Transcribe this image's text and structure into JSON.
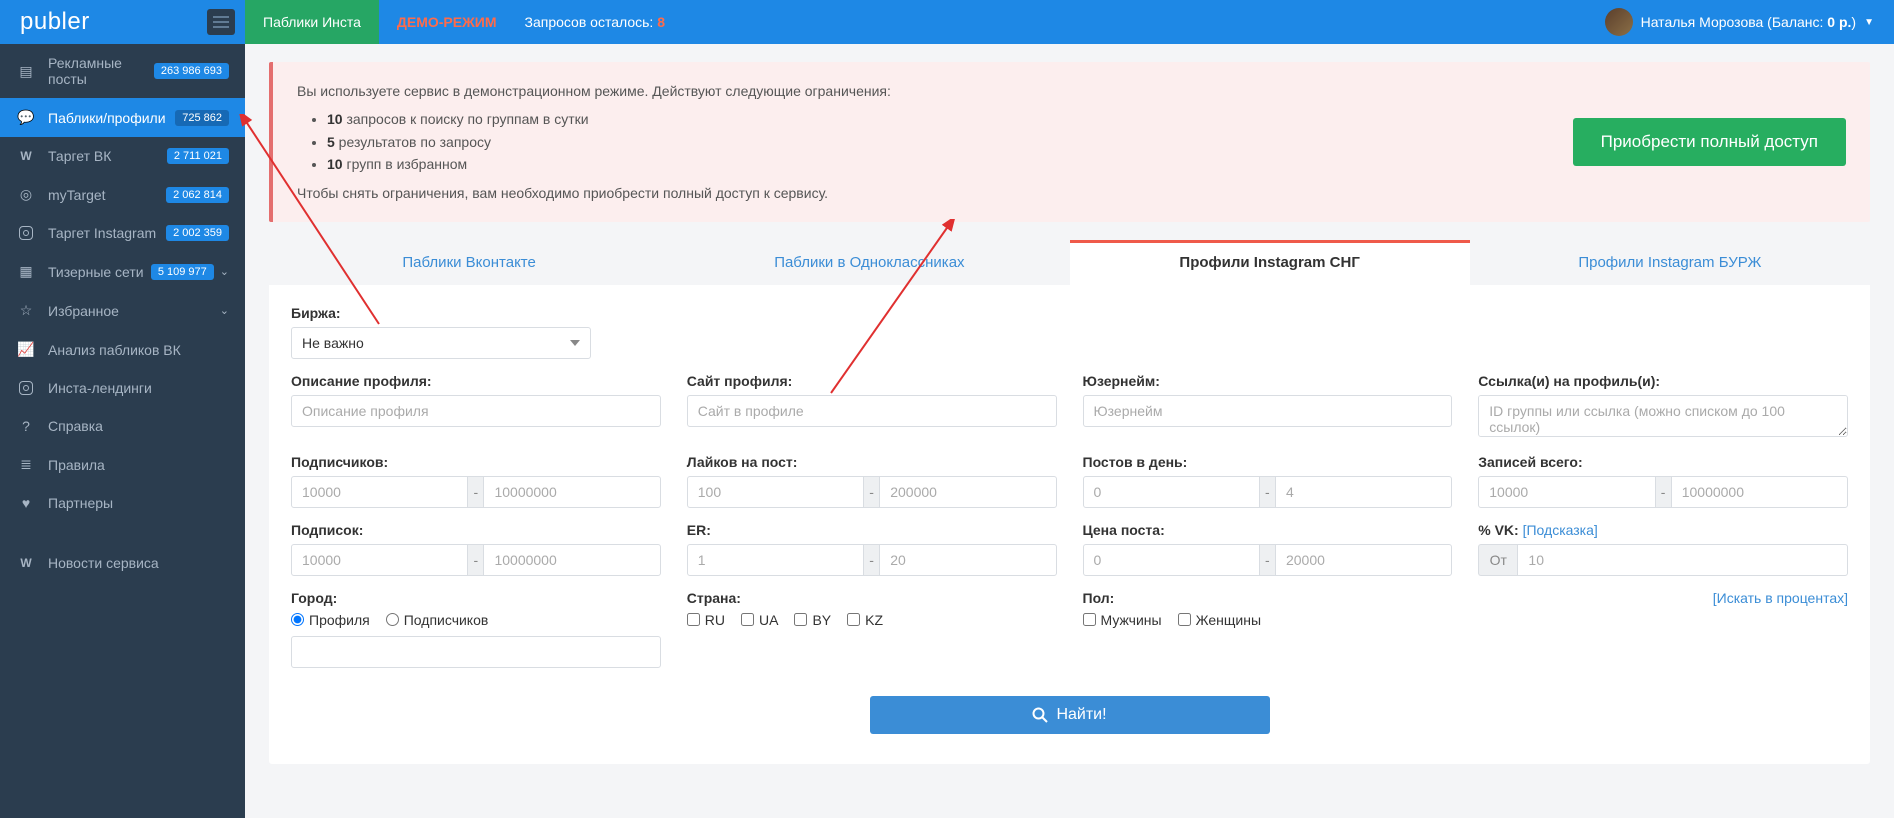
{
  "brand": "publer",
  "topnav": {
    "tab_active": "Паблики Инста",
    "demo": "ДЕМО-РЕЖИМ",
    "queries_label": "Запросов осталось:",
    "queries_count": "8"
  },
  "user": {
    "name": "Наталья Морозова (Баланс: ",
    "balance": "0 р.",
    "suffix": ")"
  },
  "sidebar": [
    {
      "icon": "▤",
      "label": "Рекламные посты",
      "badge": "263 986 693"
    },
    {
      "icon": "💬",
      "label": "Паблики/профили",
      "badge": "725 862",
      "active": true
    },
    {
      "icon": "vk",
      "label": "Таргет ВК",
      "badge": "2 711 021"
    },
    {
      "icon": "◎",
      "label": "myTarget",
      "badge": "2 062 814"
    },
    {
      "icon": "ig",
      "label": "Таргет Instagram",
      "badge": "2 002 359"
    },
    {
      "icon": "▦",
      "label": "Тизерные сети",
      "badge": "5 109 977",
      "chev": true
    },
    {
      "icon": "☆",
      "label": "Избранное",
      "chev": true
    },
    {
      "icon": "📈",
      "label": "Анализ пабликов ВК"
    },
    {
      "icon": "ig",
      "label": "Инста-лендинги"
    },
    {
      "icon": "?",
      "label": "Справка"
    },
    {
      "icon": "≣",
      "label": "Правила"
    },
    {
      "icon": "♥",
      "label": "Партнеры"
    },
    {
      "icon": "vk",
      "label": "Новости сервиса",
      "sep": true
    }
  ],
  "banner": {
    "l1": "Вы используете сервис в демонстрационном режиме. Действуют следующие ограничения:",
    "li1b": "10",
    "li1": " запросов к поиску по группам в сутки",
    "li2b": "5",
    "li2": " результатов по запросу",
    "li3b": "10",
    "li3": " групп в избранном",
    "l2": "Чтобы снять ограничения, вам необходимо приобрести полный доступ к сервису.",
    "btn": "Приобрести полный доступ"
  },
  "tabs": [
    "Паблики Вконтакте",
    "Паблики в Одноклассниках",
    "Профили Instagram СНГ",
    "Профили Instagram БУРЖ"
  ],
  "form": {
    "birzha": {
      "label": "Биржа:",
      "value": "Не важно"
    },
    "desc": {
      "label": "Описание профиля:",
      "ph": "Описание профиля"
    },
    "site": {
      "label": "Сайт профиля:",
      "ph": "Сайт в профиле"
    },
    "uname": {
      "label": "Юзернейм:",
      "ph": "Юзернейм"
    },
    "links": {
      "label": "Ссылка(и) на профиль(и):",
      "ph": "ID группы или ссылка (можно списком до 100 ссылок)"
    },
    "subs": {
      "label": "Подписчиков:",
      "from": "10000",
      "to": "10000000"
    },
    "likes": {
      "label": "Лайков на пост:",
      "from": "100",
      "to": "200000"
    },
    "ppd": {
      "label": "Постов в день:",
      "from": "0",
      "to": "4"
    },
    "total": {
      "label": "Записей всего:",
      "from": "10000",
      "to": "10000000"
    },
    "follows": {
      "label": "Подписок:",
      "from": "10000",
      "to": "10000000"
    },
    "er": {
      "label": "ER:",
      "from": "1",
      "to": "20"
    },
    "price": {
      "label": "Цена поста:",
      "from": "0",
      "to": "20000"
    },
    "vk": {
      "label": "% VK: ",
      "hint": "[Подсказка]",
      "prefix": "От",
      "ph": "10"
    },
    "city": {
      "label": "Город:",
      "r1": "Профиля",
      "r2": "Подписчиков"
    },
    "country": {
      "label": "Страна:",
      "c": [
        "RU",
        "UA",
        "BY",
        "KZ"
      ]
    },
    "sex": {
      "label": "Пол:",
      "c": [
        "Мужчины",
        "Женщины"
      ]
    },
    "percents": "[Искать в процентах]",
    "search": "Найти!"
  }
}
